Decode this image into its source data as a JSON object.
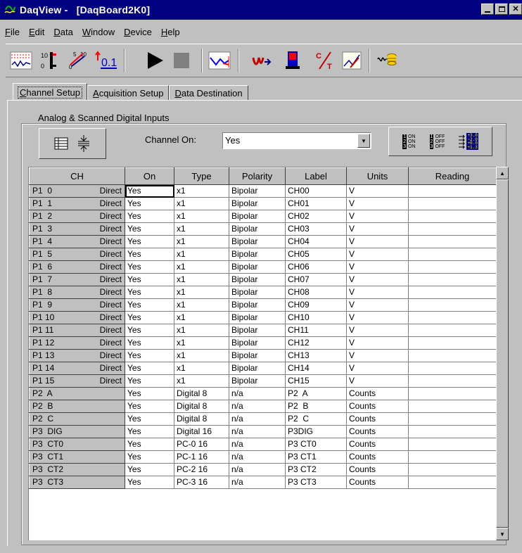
{
  "window": {
    "title": "DaqView -   [DaqBoard2K0]",
    "controls": [
      "minimize",
      "maximize",
      "close"
    ]
  },
  "menu": [
    "File",
    "Edit",
    "Data",
    "Window",
    "Device",
    "Help"
  ],
  "toolbar": {
    "buttons": [
      "channel-setup-icon",
      "scale-icon",
      "range-icon",
      "decimal-readout-icon",
      "play-icon",
      "stop-icon",
      "scope-display-icon",
      "data-transfer-icon",
      "meter-icon",
      "temperature-icon",
      "chart-display-icon",
      "waveform-database-icon"
    ],
    "decimal_label": "0.1"
  },
  "tabs": [
    {
      "label": "Channel Setup",
      "active": true
    },
    {
      "label": "Acquisition Setup",
      "active": false
    },
    {
      "label": "Data Destination",
      "active": false
    }
  ],
  "group": {
    "title": "Analog & Scanned Digital Inputs",
    "channel_on_label": "Channel On:",
    "channel_on_value": "Yes",
    "on_icon_text": [
      "ON",
      "ON",
      "ON"
    ],
    "off_icon_text": [
      "OFF",
      "OFF",
      "OFF"
    ],
    "readout_icon_text": [
      "+3.0",
      "-2.0",
      "+0.0",
      "+1.3"
    ]
  },
  "grid": {
    "columns": [
      "CH",
      "On",
      "Type",
      "Polarity",
      "Label",
      "Units",
      "Reading"
    ],
    "rows": [
      {
        "ch": "P1  0",
        "mode": "Direct",
        "on": "Yes",
        "type": "x1",
        "polarity": "Bipolar",
        "label": "CH00",
        "units": "V",
        "reading": ""
      },
      {
        "ch": "P1  1",
        "mode": "Direct",
        "on": "Yes",
        "type": "x1",
        "polarity": "Bipolar",
        "label": "CH01",
        "units": "V",
        "reading": ""
      },
      {
        "ch": "P1  2",
        "mode": "Direct",
        "on": "Yes",
        "type": "x1",
        "polarity": "Bipolar",
        "label": "CH02",
        "units": "V",
        "reading": ""
      },
      {
        "ch": "P1  3",
        "mode": "Direct",
        "on": "Yes",
        "type": "x1",
        "polarity": "Bipolar",
        "label": "CH03",
        "units": "V",
        "reading": ""
      },
      {
        "ch": "P1  4",
        "mode": "Direct",
        "on": "Yes",
        "type": "x1",
        "polarity": "Bipolar",
        "label": "CH04",
        "units": "V",
        "reading": ""
      },
      {
        "ch": "P1  5",
        "mode": "Direct",
        "on": "Yes",
        "type": "x1",
        "polarity": "Bipolar",
        "label": "CH05",
        "units": "V",
        "reading": ""
      },
      {
        "ch": "P1  6",
        "mode": "Direct",
        "on": "Yes",
        "type": "x1",
        "polarity": "Bipolar",
        "label": "CH06",
        "units": "V",
        "reading": ""
      },
      {
        "ch": "P1  7",
        "mode": "Direct",
        "on": "Yes",
        "type": "x1",
        "polarity": "Bipolar",
        "label": "CH07",
        "units": "V",
        "reading": ""
      },
      {
        "ch": "P1  8",
        "mode": "Direct",
        "on": "Yes",
        "type": "x1",
        "polarity": "Bipolar",
        "label": "CH08",
        "units": "V",
        "reading": ""
      },
      {
        "ch": "P1  9",
        "mode": "Direct",
        "on": "Yes",
        "type": "x1",
        "polarity": "Bipolar",
        "label": "CH09",
        "units": "V",
        "reading": ""
      },
      {
        "ch": "P1 10",
        "mode": "Direct",
        "on": "Yes",
        "type": "x1",
        "polarity": "Bipolar",
        "label": "CH10",
        "units": "V",
        "reading": ""
      },
      {
        "ch": "P1 11",
        "mode": "Direct",
        "on": "Yes",
        "type": "x1",
        "polarity": "Bipolar",
        "label": "CH11",
        "units": "V",
        "reading": ""
      },
      {
        "ch": "P1 12",
        "mode": "Direct",
        "on": "Yes",
        "type": "x1",
        "polarity": "Bipolar",
        "label": "CH12",
        "units": "V",
        "reading": ""
      },
      {
        "ch": "P1 13",
        "mode": "Direct",
        "on": "Yes",
        "type": "x1",
        "polarity": "Bipolar",
        "label": "CH13",
        "units": "V",
        "reading": ""
      },
      {
        "ch": "P1 14",
        "mode": "Direct",
        "on": "Yes",
        "type": "x1",
        "polarity": "Bipolar",
        "label": "CH14",
        "units": "V",
        "reading": ""
      },
      {
        "ch": "P1 15",
        "mode": "Direct",
        "on": "Yes",
        "type": "x1",
        "polarity": "Bipolar",
        "label": "CH15",
        "units": "V",
        "reading": ""
      },
      {
        "ch": "P2  A",
        "mode": "",
        "on": "Yes",
        "type": "Digital 8",
        "polarity": "n/a",
        "label": "P2  A",
        "units": "Counts",
        "reading": ""
      },
      {
        "ch": "P2  B",
        "mode": "",
        "on": "Yes",
        "type": "Digital 8",
        "polarity": "n/a",
        "label": "P2  B",
        "units": "Counts",
        "reading": ""
      },
      {
        "ch": "P2  C",
        "mode": "",
        "on": "Yes",
        "type": "Digital 8",
        "polarity": "n/a",
        "label": "P2  C",
        "units": "Counts",
        "reading": ""
      },
      {
        "ch": "P3  DIG",
        "mode": "",
        "on": "Yes",
        "type": "Digital 16",
        "polarity": "n/a",
        "label": "P3DIG",
        "units": "Counts",
        "reading": ""
      },
      {
        "ch": "P3  CT0",
        "mode": "",
        "on": "Yes",
        "type": "PC-0 16",
        "polarity": "n/a",
        "label": "P3 CT0",
        "units": "Counts",
        "reading": ""
      },
      {
        "ch": "P3  CT1",
        "mode": "",
        "on": "Yes",
        "type": "PC-1 16",
        "polarity": "n/a",
        "label": "P3 CT1",
        "units": "Counts",
        "reading": ""
      },
      {
        "ch": "P3  CT2",
        "mode": "",
        "on": "Yes",
        "type": "PC-2 16",
        "polarity": "n/a",
        "label": "P3 CT2",
        "units": "Counts",
        "reading": ""
      },
      {
        "ch": "P3  CT3",
        "mode": "",
        "on": "Yes",
        "type": "PC-3 16",
        "polarity": "n/a",
        "label": "P3 CT3",
        "units": "Counts",
        "reading": ""
      }
    ]
  },
  "colors": {
    "titlebar": "#000080",
    "face": "#c0c0c0",
    "cell_bg": "#ffffff"
  }
}
